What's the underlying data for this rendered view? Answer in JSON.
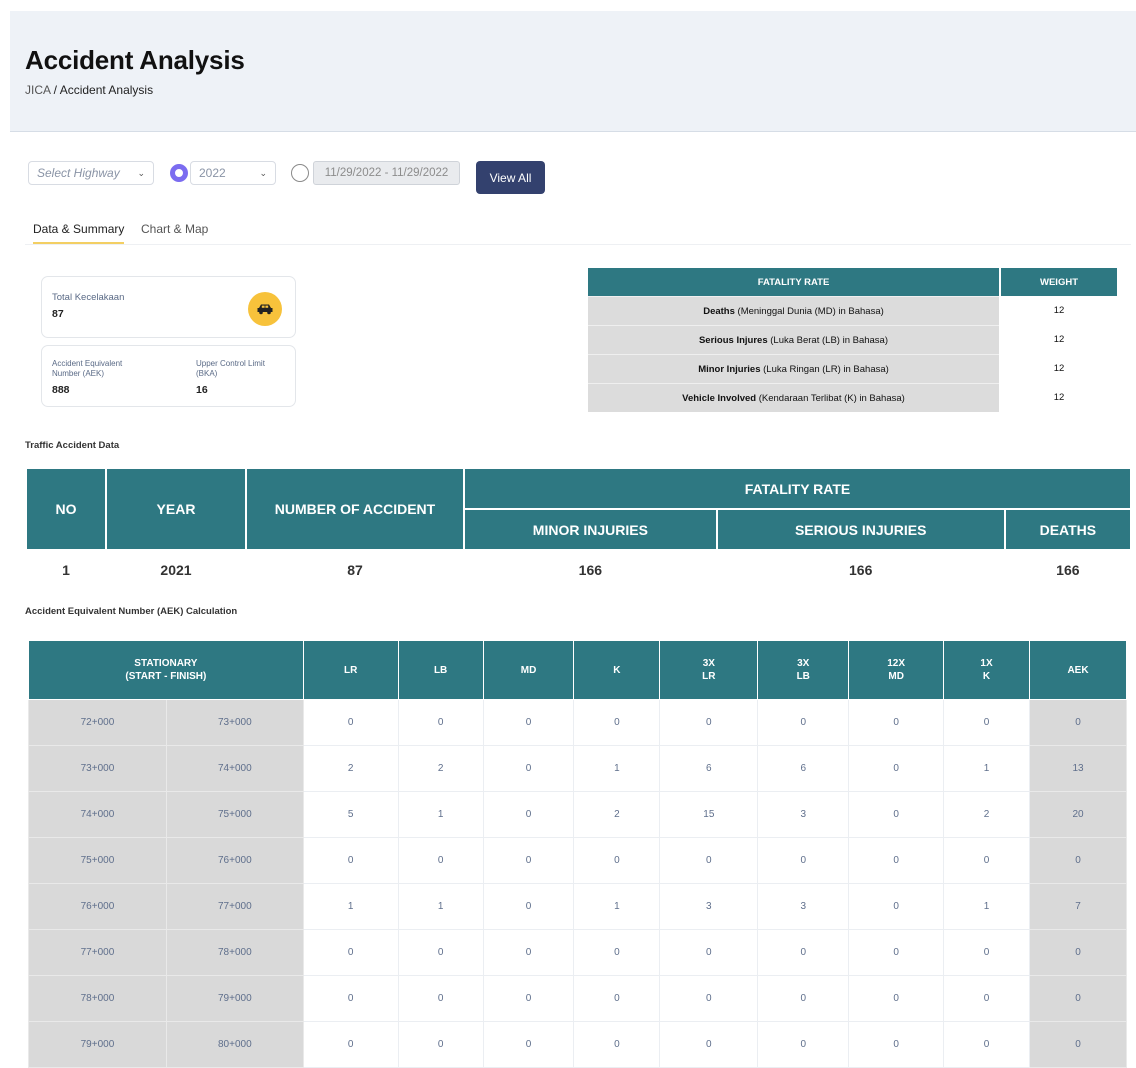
{
  "header": {
    "title": "Accident Analysis",
    "breadcrumb_root": "JICA",
    "breadcrumb_sep": " / ",
    "breadcrumb_current": "Accident Analysis"
  },
  "filters": {
    "highway_placeholder": "Select Highway",
    "year_value": "2022",
    "date_range": "11/29/2022 - 11/29/2022",
    "view_all_label": "View All",
    "radio_accent": "#7b6cf0"
  },
  "tabs": [
    {
      "label": "Data & Summary",
      "active": true
    },
    {
      "label": "Chart & Map",
      "active": false
    }
  ],
  "summary": {
    "total_label": "Total Kecelakaan",
    "total_value": "87",
    "aek_label": "Accident Equivalent Number (AEK)",
    "aek_value": "888",
    "ucl_label": "Upper Control Limit (BKA)",
    "ucl_value": "16",
    "icon": "car-icon"
  },
  "fatality_weights": {
    "header_rate": "FATALITY RATE",
    "header_weight": "WEIGHT",
    "rows": [
      {
        "bold": "Deaths",
        "rest": " (Meninggal Dunia (MD) in Bahasa)",
        "weight": "12"
      },
      {
        "bold": "Serious Injures",
        "rest": " (Luka Berat (LB) in Bahasa)",
        "weight": "12"
      },
      {
        "bold": "Minor Injuries",
        "rest": " (Luka Ringan (LR) in Bahasa)",
        "weight": "12"
      },
      {
        "bold": "Vehicle Involved",
        "rest": " (Kendaraan Terlibat (K) in Bahasa)",
        "weight": "12"
      }
    ]
  },
  "traffic_data": {
    "title": "Traffic Accident Data",
    "headers": {
      "no": "NO",
      "year": "YEAR",
      "accidents": "NUMBER OF ACCIDENT",
      "fatality": "FATALITY RATE",
      "minor": "MINOR INJURIES",
      "serious": "SERIOUS INJURIES",
      "deaths": "DEATHS"
    },
    "row": {
      "no": "1",
      "year": "2021",
      "accidents": "87",
      "minor": "166",
      "serious": "166",
      "deaths": "166"
    }
  },
  "aek_table": {
    "title": "Accident Equivalent Number (AEK) Calculation",
    "headers": {
      "stationary_1": "STATIONARY",
      "stationary_2": "(START - FINISH)",
      "lr": "LR",
      "lb": "LB",
      "md": "MD",
      "k": "K",
      "lr3_1": "3X",
      "lr3_2": "LR",
      "lb3_1": "3X",
      "lb3_2": "LB",
      "md12_1": "12X",
      "md12_2": "MD",
      "k1_1": "1X",
      "k1_2": "K",
      "aek": "AEK"
    },
    "rows": [
      [
        "72+000",
        "73+000",
        "0",
        "0",
        "0",
        "0",
        "0",
        "0",
        "0",
        "0",
        "0"
      ],
      [
        "73+000",
        "74+000",
        "2",
        "2",
        "0",
        "1",
        "6",
        "6",
        "0",
        "1",
        "13"
      ],
      [
        "74+000",
        "75+000",
        "5",
        "1",
        "0",
        "2",
        "15",
        "3",
        "0",
        "2",
        "20"
      ],
      [
        "75+000",
        "76+000",
        "0",
        "0",
        "0",
        "0",
        "0",
        "0",
        "0",
        "0",
        "0"
      ],
      [
        "76+000",
        "77+000",
        "1",
        "1",
        "0",
        "1",
        "3",
        "3",
        "0",
        "1",
        "7"
      ],
      [
        "77+000",
        "78+000",
        "0",
        "0",
        "0",
        "0",
        "0",
        "0",
        "0",
        "0",
        "0"
      ],
      [
        "78+000",
        "79+000",
        "0",
        "0",
        "0",
        "0",
        "0",
        "0",
        "0",
        "0",
        "0"
      ],
      [
        "79+000",
        "80+000",
        "0",
        "0",
        "0",
        "0",
        "0",
        "0",
        "0",
        "0",
        "0"
      ]
    ]
  },
  "colors": {
    "teal_header": "#2e7882",
    "primary_button": "#33416e",
    "icon_bg": "#f7c23b"
  }
}
